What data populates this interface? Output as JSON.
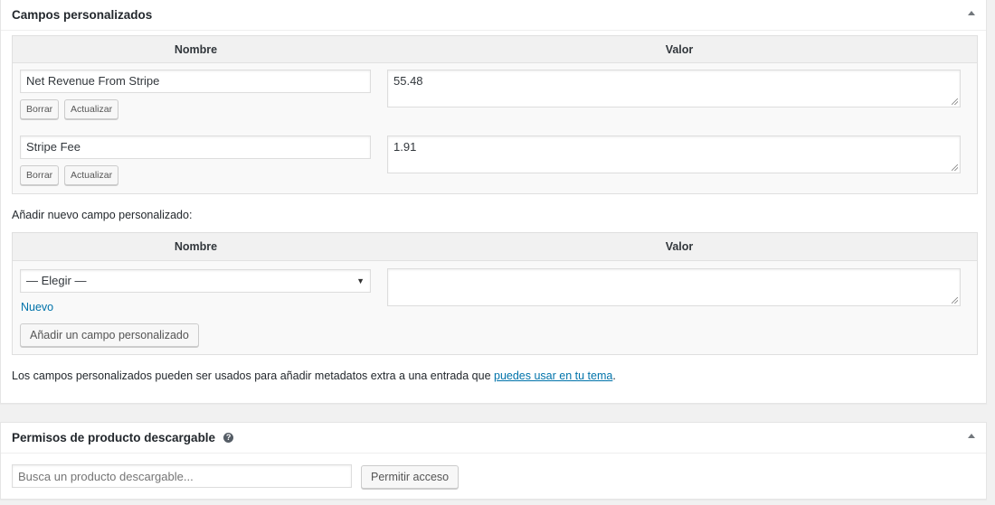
{
  "custom_fields": {
    "title": "Campos personalizados",
    "col_name": "Nombre",
    "col_value": "Valor",
    "rows": [
      {
        "name": "Net Revenue From Stripe",
        "value": "55.48",
        "delete_label": "Borrar",
        "update_label": "Actualizar"
      },
      {
        "name": "Stripe Fee",
        "value": "1.91",
        "delete_label": "Borrar",
        "update_label": "Actualizar"
      }
    ],
    "add_new_heading": "Añadir nuevo campo personalizado:",
    "new_col_name": "Nombre",
    "new_col_value": "Valor",
    "select_value": "— Elegir —",
    "new_link": "Nuevo",
    "add_button": "Añadir un campo personalizado",
    "footer_text": "Los campos personalizados pueden ser usados para añadir metadatos extra a una entrada que ",
    "footer_link": "puedes usar en tu tema",
    "footer_end": "."
  },
  "download_permissions": {
    "title": "Permisos de producto descargable",
    "search_placeholder": "Busca un producto descargable...",
    "grant_button": "Permitir acceso"
  },
  "colors": {
    "link": "#0073aa",
    "header_bg": "#f1f1f1",
    "table_bg": "#f9f9f9"
  },
  "icons": {
    "collapse": "triangle-up-icon",
    "help": "question-circle-icon",
    "select": "chevron-down-icon",
    "resize": "resize-grip-icon"
  }
}
